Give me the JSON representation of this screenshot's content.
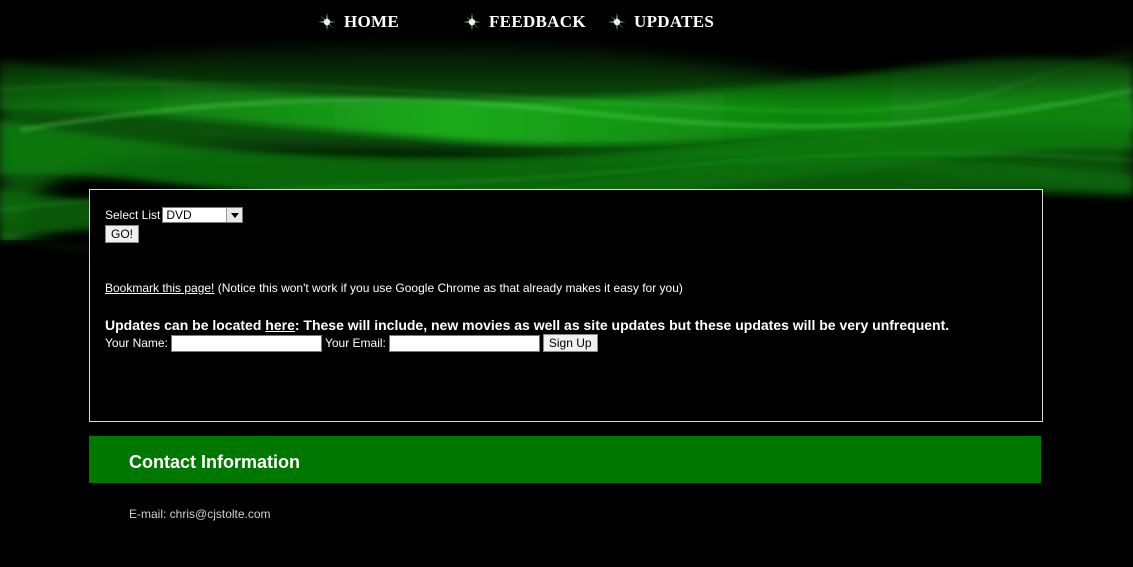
{
  "nav": {
    "items": [
      {
        "label": "HOME",
        "icon": "sparkle-icon"
      },
      {
        "label": "FEEDBACK",
        "icon": "sparkle-icon"
      },
      {
        "label": "UPDATES",
        "icon": "sparkle-icon"
      }
    ]
  },
  "main": {
    "select_label": "Select List",
    "select_value": "DVD",
    "go_label": "GO!",
    "bookmark_link": "Bookmark this page!",
    "bookmark_note": " (Notice this won't work if you use Google Chrome as that already makes it easy for you)",
    "updates_prefix": "Updates can be located ",
    "updates_link": "here",
    "updates_suffix": ": These will include, new movies as well as site updates but these updates will be very unfrequent.",
    "name_label": "Your Name:",
    "email_label": "Your Email:",
    "signup_label": "Sign Up"
  },
  "contact": {
    "title": "Contact Information",
    "email": "E-mail: chris@cjstolte.com"
  },
  "colors": {
    "background": "#000000",
    "accent_green": "#007800",
    "hero_green": "#22cc22",
    "text": "#ffffff"
  }
}
